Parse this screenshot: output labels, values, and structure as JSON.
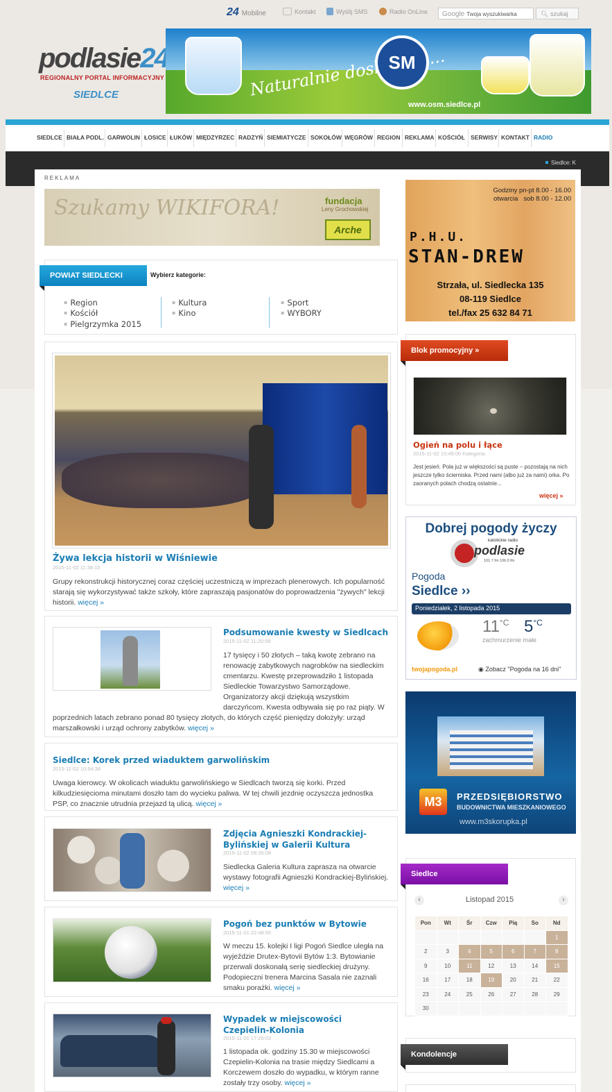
{
  "topbar": {
    "mobile_brand": "24",
    "mobile": "Mobilne",
    "contact": "Kontakt",
    "sms": "Wyślij SMS",
    "radio": "Radio OnLine",
    "search_placeholder": "Twoja wyszukiwarka",
    "search_brand": "Google",
    "search_button": "szukaj"
  },
  "header": {
    "logo_main": "podlasie",
    "logo_num": "24",
    "logo_sub": "REGIONALNY PORTAL INFORMACYJNY",
    "city": "SIEDLCE",
    "banner_slogan": "Naturalnie doskonałe...",
    "banner_logo": "SM",
    "banner_url": "www.osm.siedlce.pl"
  },
  "nav": [
    "SIEDLCE",
    "BIAŁA PODL.",
    "GARWOLIN",
    "ŁOSICE",
    "ŁUKÓW",
    "MIĘDZYRZEC",
    "RADZYŃ",
    "SIEMIATYCZE",
    "SOKOŁÓW",
    "WĘGRÓW",
    "REGION",
    "REKLAMA",
    "KOŚCIÓŁ",
    "SERWISY",
    "KONTAKT",
    "RADIO"
  ],
  "ticker": "Siedlce: K",
  "reklama": "REKLAMA",
  "wiki_banner": {
    "text": "Szukamy WIKIFORA!",
    "fundacja": "fundacja",
    "leny": "Leny Grochowskiej",
    "arche": "Arche"
  },
  "powiat": {
    "title": "POWIAT SIEDLECKI",
    "choose": "Wybierz kategorie:",
    "col1": [
      "Region",
      "Kościół",
      "Pielgrzymka 2015"
    ],
    "col2": [
      "Kultura",
      "Kino"
    ],
    "col3": [
      "Sport",
      "WYBORY"
    ]
  },
  "articles": [
    {
      "title": "Żywa lekcja historii w Wiśniewie",
      "date": "2015-11-02 11:38:15",
      "text": "Grupy rekonstrukcji historycznej coraz częściej uczestniczą w imprezach plenerowych. Ich popularność starają się wykorzystywać także szkoły, które zapraszają pasjonatów do poprowadzenia \"żywych\" lekcji historii.",
      "more": "więcej »"
    },
    {
      "title": "Podsumowanie kwesty w Siedlcach",
      "date": "2015-11-02 11:20:58",
      "text": "17 tysięcy i 50 złotych – taką kwotę zebrano na renowację zabytkowych nagrobków na siedleckim cmentarzu. Kwestę przeprowadziło 1 listopada Siedleckie Towarzystwo Samorządowe. Organizatorzy akcji dziękują wszystkim darczyńcom. Kwesta odbywała się po raz piąty. W poprzednich latach zebrano ponad 80 tysięcy złotych, do których część pieniędzy dołożyły: urząd marszałkowski i urząd ochrony zabytków.",
      "more": "więcej »"
    },
    {
      "title": "Siedlce: Korek przed wiaduktem garwolińskim",
      "date": "2015-11-02 10:54:38",
      "text": "Uwaga kierowcy. W okolicach wiaduktu garwolińskiego w Siedlcach tworzą się korki. Przed kilkudziesięcioma minutami doszło tam do wycieku paliwa. W tej chwili jezdnię oczyszcza jednostka PSP, co znacznie utrudnia przejazd tą ulicą.",
      "more": "więcej »"
    },
    {
      "title": "Zdjęcia Agnieszki Kondrackiej-Bylińskiej w Galerii Kultura",
      "date": "2015-11-02 08:35:08",
      "text": "Siedlecka Galeria Kultura zaprasza na otwarcie wystawy fotografii Agnieszki Kondrackiej-Bylińskiej.",
      "more": "więcej »"
    },
    {
      "title": "Pogoń bez punktów w Bytowie",
      "date": "2015-11-01 22:48:55",
      "text": "W meczu 15. kolejki I ligi Pogoń Siedlce uległa na wyjeździe Drutex-Bytovii Bytów 1:3. Bytowianie przerwali doskonałą serię siedleckiej drużyny. Podopieczni trenera Marcina Sasala nie zaznali smaku porażki.",
      "more": "więcej »"
    },
    {
      "title": "Wypadek w miejscowości Czepielin-Kolonia",
      "date": "2015-11-01 17:26:03",
      "text": "1 listopada ok. godziny 15.30 w miejscowości Czepielin-Kolonia na trasie między Siedlcami a Korczewem doszło do wypadku, w którym ranne zostały trzy osoby.",
      "more": "więcej »"
    }
  ],
  "side_ad": {
    "hours_label": "Godziny pn-pt 8.00 - 16.00",
    "hours2": "otwarcia   sob 8.00 - 12.00",
    "phu": "P.H.U.",
    "name": "STAN-DREW",
    "addr": "Strzała, ul. Siedlecka 135",
    "zip": "08-119 Siedlce",
    "tel": "tel./fax 25 632 84 71"
  },
  "promo": {
    "title": "Blok promocyjny »",
    "headline": "Ogień na polu i łące",
    "date": "2015-11-02 10:49:06 Kategoria:",
    "text": "Jest jesień. Pola już w większości są puste – pozostają na nich jeszcze tylko ścierniska. Przed nami (albo już za nami) orka. Po zaoranych polach chodzą ostatnie...",
    "more": "więcej »"
  },
  "weather": {
    "title": "Dobrej pogody życzy",
    "radio_small": "katolickie radio",
    "radio_brand": "podlasie",
    "freq": "101.7 fm 106.0 fm",
    "pogoda": "Pogoda",
    "city": "Siedlce ››",
    "date": "Poniedziałek, 2 listopada 2015",
    "t1": "11",
    "t2": "5",
    "unit": "°C",
    "desc": "zachmurzenie małe",
    "brand": "twojapogoda.pl",
    "link": "Zobacz \"Pogoda na 16 dni\""
  },
  "m3": {
    "name": "PRZEDSIĘBIORSTWO",
    "sub": "BUDOWNICTWA MIESZKANIOWEGO",
    "url": "www.m3skorupka.pl",
    "logo": "M3"
  },
  "calendar": {
    "title": "Siedlce",
    "month": "Listopad 2015",
    "prev": "‹",
    "next": "›",
    "days": [
      "Pon",
      "Wt",
      "Śr",
      "Czw",
      "Pią",
      "So",
      "Nd"
    ],
    "weeks": [
      [
        "",
        "",
        "",
        "",
        "",
        "",
        "1"
      ],
      [
        "2",
        "3",
        "4",
        "5",
        "6",
        "7",
        "8"
      ],
      [
        "9",
        "10",
        "11",
        "12",
        "13",
        "14",
        "15"
      ],
      [
        "16",
        "17",
        "18",
        "19",
        "20",
        "21",
        "22"
      ],
      [
        "23",
        "24",
        "25",
        "26",
        "27",
        "28",
        "29"
      ],
      [
        "30",
        "",
        "",
        "",
        "",
        "",
        ""
      ]
    ],
    "highlighted": [
      "1",
      "4",
      "5",
      "6",
      "7",
      "8",
      "11",
      "15",
      "19"
    ]
  },
  "kondolencje": "Kondolencje",
  "colors": {
    "accent": "#1a7db4",
    "cyan": "#2ba4d6",
    "promo": "#c83512",
    "purple": "#8a1bb5"
  }
}
